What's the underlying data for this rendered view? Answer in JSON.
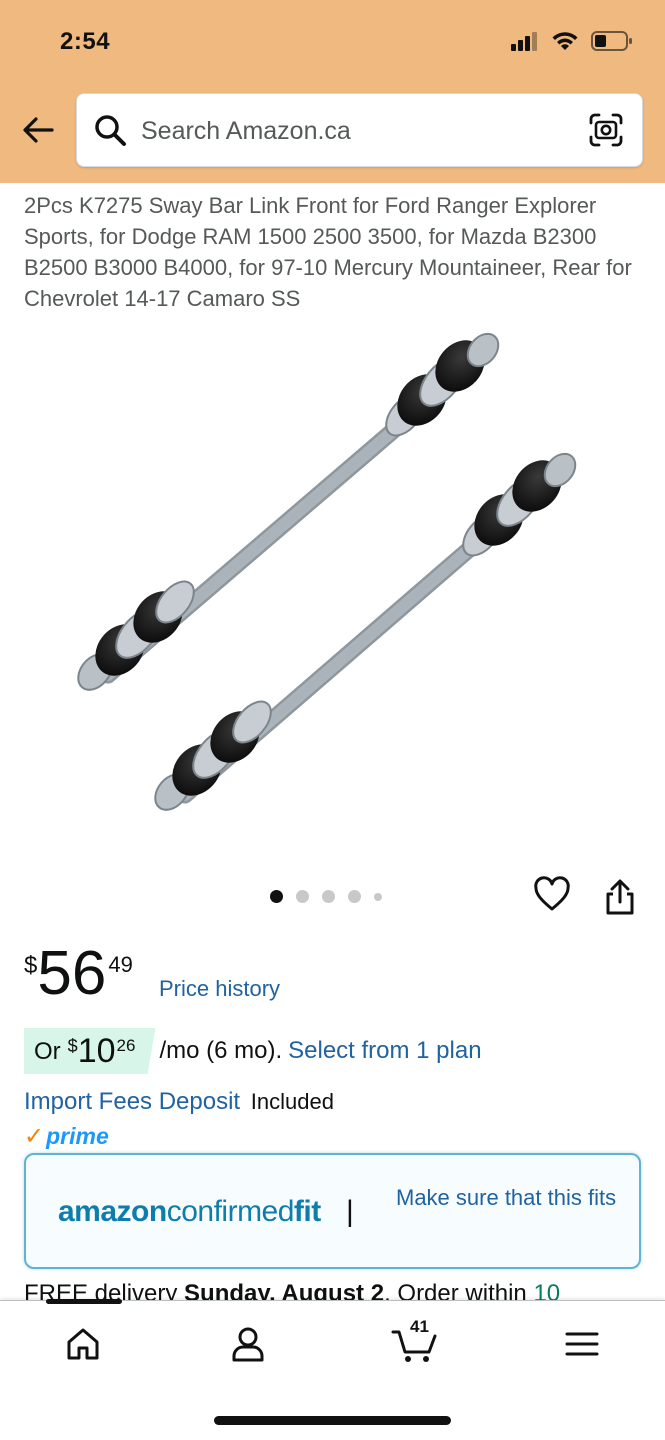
{
  "status_bar": {
    "time": "2:54"
  },
  "search": {
    "placeholder": "Search Amazon.ca"
  },
  "product": {
    "title": "2Pcs K7275 Sway Bar Link Front for Ford Ranger Explorer Sports, for Dodge RAM 1500 2500 3500, for Mazda B2300 B2500 B3000 B4000, for 97-10 Mercury Mountaineer, Rear for Chevrolet 14-17 Camaro SS",
    "image_count": 5,
    "active_image": 1
  },
  "price": {
    "symbol": "$",
    "whole": "56",
    "fraction": "49",
    "history_label": "Price history"
  },
  "installment": {
    "or_label": "Or",
    "symbol": "$",
    "whole": "10",
    "fraction": "26",
    "terms": "/mo (6 mo).",
    "link": "Select from 1 plan"
  },
  "import_fees": {
    "link": "Import Fees Deposit",
    "status": "Included"
  },
  "prime": {
    "check": "✓",
    "label": "prime"
  },
  "confirmed_fit": {
    "logo_part1": "amazon",
    "logo_part2": "confirmed",
    "logo_part3": "fit",
    "separator": "|",
    "message": "Make sure that this fits"
  },
  "delivery": {
    "prefix": "FREE delivery ",
    "date": "Sunday, August 2",
    "middle": ". Order within ",
    "time": "10"
  },
  "bottom_nav": {
    "cart_count": "41"
  },
  "colors": {
    "header_bg": "#f0b97f",
    "link": "#2162a1",
    "installment_badge": "#d7f5e8",
    "prime_blue": "#1a98ff",
    "prime_check": "#f08804",
    "fit_border": "#62b3d1"
  }
}
